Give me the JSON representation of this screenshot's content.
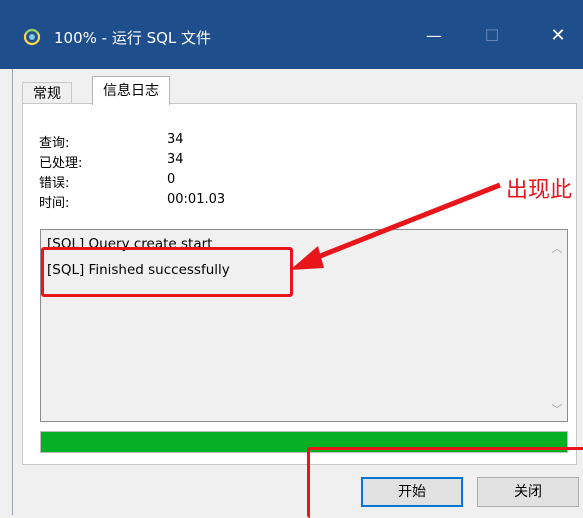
{
  "window": {
    "title": "100% - 运行 SQL 文件",
    "controls": {
      "minimize": "—",
      "maximize": "☐",
      "close": "✕"
    }
  },
  "tabs": [
    {
      "label": "常规"
    },
    {
      "label": "信息日志"
    }
  ],
  "info": [
    {
      "label": "查询:",
      "value": "34"
    },
    {
      "label": "已处理:",
      "value": "34"
    },
    {
      "label": "错误:",
      "value": "0"
    },
    {
      "label": "时间:",
      "value": "00:01.03"
    }
  ],
  "log": {
    "lines": [
      "[SQL] Query create start",
      "[SQL] Finished successfully"
    ]
  },
  "progress": {
    "percent": 100,
    "color": "#06b025"
  },
  "buttons": {
    "start": "开始",
    "close": "关闭"
  },
  "annotation": {
    "text": "出现此",
    "color": "#e8161b"
  }
}
